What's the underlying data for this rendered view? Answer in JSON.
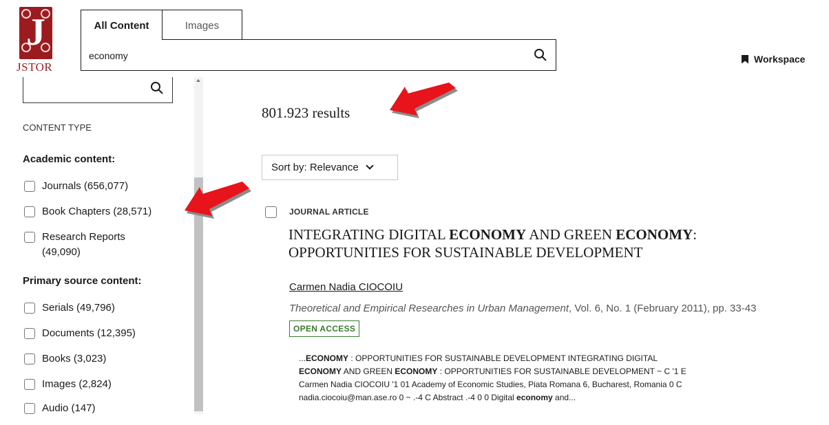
{
  "header": {
    "logo_text": "JSTOR",
    "tabs": [
      {
        "label": "All Content",
        "active": true
      },
      {
        "label": "Images",
        "active": false
      }
    ],
    "search_value": "economy",
    "workspace_label": "Workspace"
  },
  "sidebar": {
    "content_type_label": "CONTENT TYPE",
    "academic_heading": "Academic content:",
    "academic_filters": [
      "Journals (656,077)",
      "Book Chapters (28,571)",
      "Research Reports (49,090)"
    ],
    "primary_heading": "Primary source content:",
    "primary_filters": [
      "Serials (49,796)",
      "Documents (12,395)",
      "Books (3,023)",
      "Images (2,824)",
      "Audio (147)"
    ]
  },
  "main": {
    "results_count": "801.923 results",
    "sort_label": "Sort by: Relevance",
    "article": {
      "type": "JOURNAL ARTICLE",
      "title_parts": [
        "INTEGRATING DIGITAL ",
        "ECONOMY",
        " AND GREEN ",
        "ECONOMY",
        ": OPPORTUNITIES FOR SUSTAINABLE DEVELOPMENT"
      ],
      "author": "Carmen Nadia CIOCOIU",
      "source_journal": "Theoretical and Empirical Researches in Urban Management",
      "source_details": ", Vol. 6, No. 1 (February 2011), pp. 33-43",
      "badge": "OPEN ACCESS",
      "snippet_parts": [
        "...",
        "ECONOMY",
        " : OPPORTUNITIES FOR SUSTAINABLE DEVELOPMENT INTEGRATING DIGITAL ",
        "ECONOMY",
        " AND GREEN ",
        "ECONOMY",
        " : OPPORTUNITIES FOR SUSTAINABLE DEVELOPMENT ~ C '1 E Carmen Nadia CIOCOIU '1 01 Academy of Economic Studies, Piata Romana 6, Bucharest, Romania 0 C nadia.ciocoiu@man.ase.ro 0 ~ .-4 C Abstract .-4 0 0 Digital ",
        "economy",
        " and..."
      ]
    }
  },
  "colors": {
    "brand_red": "#9b1b1f",
    "open_access_green": "#3a7a2c",
    "annotation_arrow": "#e8141b"
  }
}
